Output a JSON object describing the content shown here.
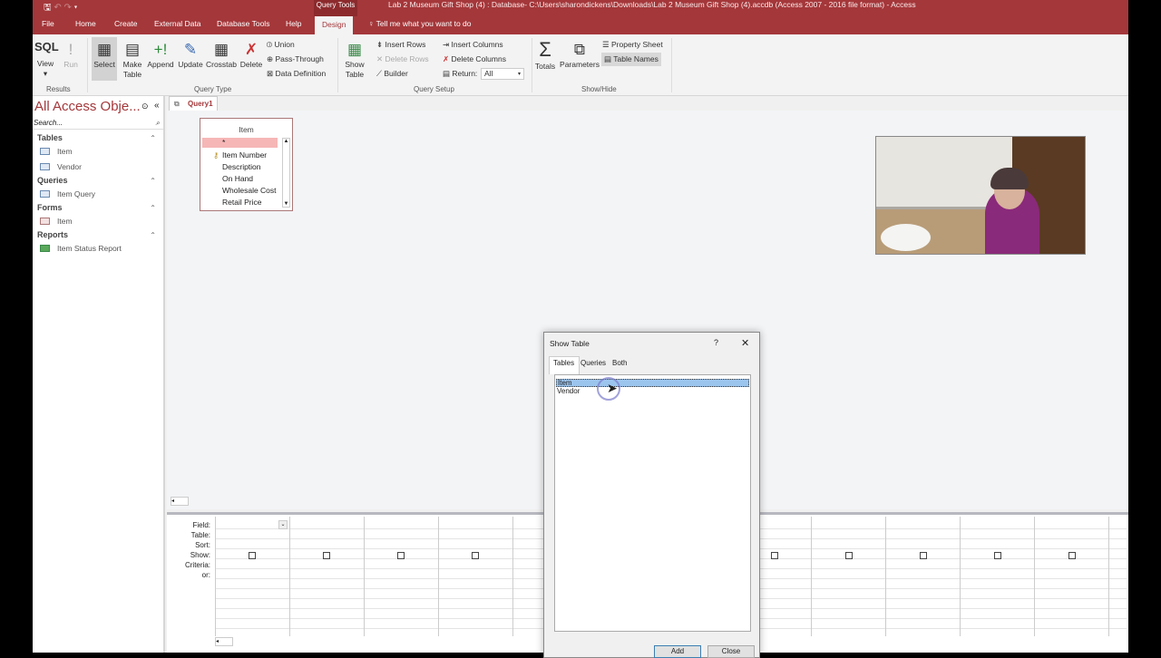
{
  "titlebar": {
    "context_tab": "Query Tools",
    "title": "Lab 2 Museum Gift Shop (4) : Database- C:\\Users\\sharondickens\\Downloads\\Lab 2 Museum Gift Shop (4).accdb (Access 2007 - 2016 file format) - Access"
  },
  "tabs": [
    "File",
    "Home",
    "Create",
    "External Data",
    "Database Tools",
    "Help",
    "Design"
  ],
  "tell_me": "Tell me what you want to do",
  "ribbon": {
    "results": {
      "label": "Results",
      "view": "View",
      "run": "Run",
      "sql": "SQL"
    },
    "query_type": {
      "label": "Query Type",
      "select": "Select",
      "make_table": "Make Table",
      "append": "Append",
      "update": "Update",
      "crosstab": "Crosstab",
      "delete": "Delete",
      "union": "Union",
      "pass_through": "Pass-Through",
      "data_definition": "Data Definition"
    },
    "query_setup": {
      "label": "Query Setup",
      "show_table": "Show Table",
      "insert_rows": "Insert Rows",
      "delete_rows": "Delete Rows",
      "builder": "Builder",
      "insert_columns": "Insert Columns",
      "delete_columns": "Delete Columns",
      "return_label": "Return:",
      "return_value": "All"
    },
    "show_hide": {
      "label": "Show/Hide",
      "totals": "Totals",
      "parameters": "Parameters",
      "property_sheet": "Property Sheet",
      "table_names": "Table Names"
    }
  },
  "nav": {
    "title": "All Access Obje...",
    "search_placeholder": "Search...",
    "sections": [
      {
        "name": "Tables",
        "items": [
          "Item",
          "Vendor"
        ]
      },
      {
        "name": "Queries",
        "items": [
          "Item Query"
        ]
      },
      {
        "name": "Forms",
        "items": [
          "Item"
        ]
      },
      {
        "name": "Reports",
        "items": [
          "Item Status Report"
        ]
      }
    ]
  },
  "doc_tab": "Query1",
  "field_list": {
    "title": "Item",
    "fields": [
      "*",
      "Item Number",
      "Description",
      "On Hand",
      "Wholesale Cost",
      "Retail Price"
    ]
  },
  "grid": {
    "row_labels": [
      "Field:",
      "Table:",
      "Sort:",
      "Show:",
      "Criteria:",
      "or:"
    ]
  },
  "dialog": {
    "title": "Show Table",
    "help": "?",
    "close": "✕",
    "tabs": [
      "Tables",
      "Queries",
      "Both"
    ],
    "items": [
      "Item",
      "Vendor"
    ],
    "add": "Add",
    "close_button": "Close"
  }
}
